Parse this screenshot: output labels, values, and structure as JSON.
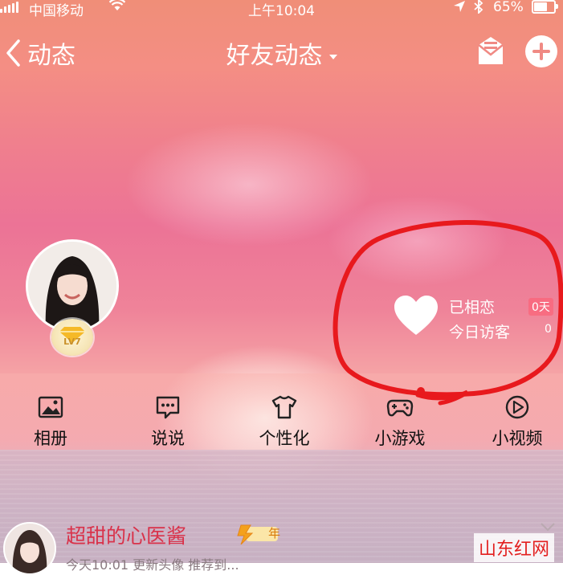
{
  "status_bar": {
    "carrier": "中国移动",
    "time": "上午10:04",
    "battery": "65%"
  },
  "nav": {
    "back_label": "动态",
    "title": "好友动态"
  },
  "profile": {
    "level": "LV7"
  },
  "love_stats": {
    "together_label": "已相恋",
    "together_value": "0天",
    "visitors_label": "今日访客",
    "visitors_value": "0"
  },
  "features": [
    {
      "label": "相册",
      "icon": "photo-album-icon"
    },
    {
      "label": "说说",
      "icon": "chat-bubble-icon"
    },
    {
      "label": "个性化",
      "icon": "tshirt-icon"
    },
    {
      "label": "小游戏",
      "icon": "gamepad-icon"
    },
    {
      "label": "小视频",
      "icon": "play-circle-icon"
    }
  ],
  "feed": {
    "name": "超甜的心医酱",
    "vip_badge": "年",
    "subtitle": "今天10:01   更新头像 推荐到..."
  },
  "watermark": "山东红网",
  "colors": {
    "accent_red": "#e31f1f",
    "name_red": "#d9324a"
  }
}
